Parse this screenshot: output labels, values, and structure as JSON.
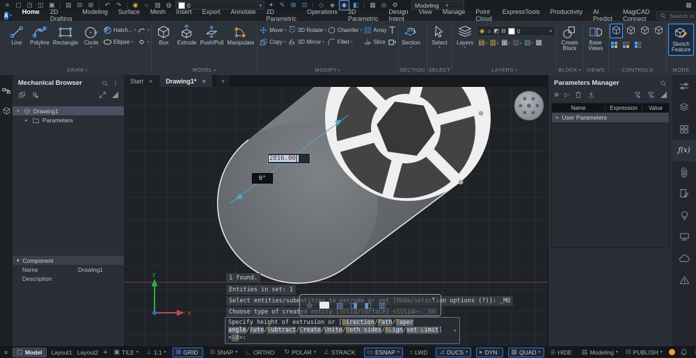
{
  "app": {
    "workspace": "Modeling",
    "search_placeholder": "Search in Ribbon"
  },
  "titlebar": {
    "layer_value": "0"
  },
  "icons": {
    "hamburger": "≡",
    "kebab": "⋮",
    "caret": "▾",
    "close": "×",
    "plus": "+",
    "new": "▢",
    "open": "◳",
    "save": "◫",
    "save_all": "▣",
    "preview": "▤",
    "print": "⊟",
    "plot": "⊞",
    "undo": "↶",
    "redo": "↷",
    "bulb": "◉",
    "sun": "☼",
    "transparency": "▨",
    "render": "◍",
    "annotate_wand": "✦",
    "annotate_pencil": "✎",
    "select_add": "⊞",
    "select_sub": "⊡",
    "view_wire": "◇",
    "view_hidden": "◈",
    "view_shaded": "◆",
    "view_real": "◧",
    "table": "▦",
    "draworder": "◎",
    "gear": "⚙",
    "grip": "▦",
    "fx": "ƒ(x)",
    "orange_dot": "",
    "up_arrow": "▴"
  },
  "menubar": {
    "tabs": [
      {
        "label": "Home",
        "active": true
      },
      {
        "label": "2D Drafting"
      },
      {
        "label": "Modeling"
      },
      {
        "label": "Surface"
      },
      {
        "label": "Mesh"
      },
      {
        "label": "Insert"
      },
      {
        "label": "Export"
      },
      {
        "label": "Annotate"
      },
      {
        "label": "2D Parametric"
      },
      {
        "label": "Operations"
      },
      {
        "label": "3D Parametric"
      },
      {
        "label": "Design Intent"
      },
      {
        "label": "View"
      },
      {
        "label": "Manage"
      },
      {
        "label": "Point Cloud"
      },
      {
        "label": "ExpressTools"
      },
      {
        "label": "Productivity"
      },
      {
        "label": "AI Predict"
      },
      {
        "label": "MagiCAD Connect"
      }
    ]
  },
  "ribbon": {
    "draw": {
      "label": "DRAW",
      "tools": [
        "Line",
        "Polyline",
        "Rectangle",
        "Circle"
      ],
      "small": [
        "Hatch...",
        "Ellipse"
      ]
    },
    "model": {
      "label": "MODEL",
      "tools": [
        "Box",
        "Extrude",
        "Push/Pull",
        "Manipulate"
      ]
    },
    "modify": {
      "label": "MODIFY",
      "row1": [
        "Move",
        "3D Rotate",
        "Chamfer",
        "Array"
      ],
      "row2": [
        "Copy",
        "3D Mirror",
        "Fillet",
        "Slice"
      ]
    },
    "section": {
      "label": "SECTION",
      "tool": "Section"
    },
    "select": {
      "label": "SELECT",
      "tool": "Select"
    },
    "layers": {
      "label": "LAYERS",
      "tool": "Layers",
      "layer_value": "0"
    },
    "block": {
      "label": "BLOCK",
      "tool": "Create Block"
    },
    "views": {
      "label": "VIEWS",
      "tool": "Base Views"
    },
    "controls": {
      "label": "CONTROLS"
    },
    "mode": {
      "label": "MODE",
      "tool": "Sketch Feature"
    }
  },
  "doc_tabs": [
    {
      "label": "Start"
    },
    {
      "label": "Drawing1*",
      "active": true
    }
  ],
  "mech_browser": {
    "title": "Mechanical Browser",
    "tree": {
      "root": "Drawing1",
      "child": "Parameters"
    },
    "component": {
      "title": "Component",
      "name_label": "Name",
      "name_value": "Drawing1",
      "desc_label": "Description",
      "desc_value": ""
    }
  },
  "params_manager": {
    "title": "Parameters Manager",
    "columns": [
      "Name",
      "Expression",
      "Value"
    ],
    "group_row": "User Parameters"
  },
  "viewport": {
    "dim_value": "2816.00",
    "angle_value": "0°",
    "axis_x": "X",
    "axis_y": "Y"
  },
  "command": {
    "history": [
      [
        [
          "p",
          "1 found."
        ]
      ],
      [
        [
          "p",
          "Entities in set: 1"
        ]
      ],
      [
        [
          "p",
          "Select entities/subentities to extrude or set ["
        ],
        [
          "h",
          "MO"
        ],
        [
          "p",
          "de/selection options (?)]: _MO"
        ]
      ],
      [
        [
          "p",
          "Choose type of created entity ["
        ],
        [
          "h",
          "SO"
        ],
        [
          "p",
          "lid/"
        ],
        [
          "h",
          "SU"
        ],
        [
          "p",
          "rface] <"
        ],
        [
          "h",
          "SO"
        ],
        [
          "p",
          "lid>: _SO"
        ]
      ]
    ],
    "prompt": [
      [
        [
          "p",
          "Specify height of extrusion or ["
        ],
        [
          "o",
          "D"
        ],
        [
          "k",
          "irection"
        ],
        [
          "p",
          "/"
        ],
        [
          "o",
          "P"
        ],
        [
          "k",
          "ath"
        ],
        [
          "p",
          "/"
        ],
        [
          "o",
          "T"
        ],
        [
          "k",
          "aper"
        ]
      ],
      [
        [
          "k",
          "angle"
        ],
        [
          "p",
          "/"
        ],
        [
          "o",
          "A"
        ],
        [
          "k",
          "uto"
        ],
        [
          "p",
          "/"
        ],
        [
          "o",
          "S"
        ],
        [
          "k",
          "ubtract"
        ],
        [
          "p",
          "/"
        ],
        [
          "o",
          "C"
        ],
        [
          "k",
          "reate"
        ],
        [
          "p",
          "/"
        ],
        [
          "o",
          "U"
        ],
        [
          "k",
          "nite"
        ],
        [
          "p",
          "/"
        ],
        [
          "o",
          "B"
        ],
        [
          "k",
          "oth sides"
        ],
        [
          "p",
          "/"
        ],
        [
          "o",
          "AL"
        ],
        [
          "k",
          "ign"
        ],
        [
          "p",
          "/"
        ],
        [
          "k",
          "set "
        ],
        [
          "o",
          "L"
        ],
        [
          "k",
          "imit"
        ],
        [
          "p",
          "]"
        ]
      ],
      [
        [
          "p",
          "<"
        ],
        [
          "vk",
          "-4"
        ],
        [
          "p",
          ">:"
        ]
      ]
    ]
  },
  "statusbar": {
    "model_tab": "Model",
    "layouts": [
      "Layout1",
      "Layout2"
    ],
    "toggles": [
      {
        "label": "TILE",
        "icon": "▣",
        "caret": "▾"
      },
      {
        "label": "1:1",
        "icon": "⊥",
        "caret": "▾",
        "color": "#4da3ff"
      },
      {
        "label": "GRID",
        "icon": "⊞",
        "cls": "on",
        "caret": "",
        "color": "#4da3ff"
      },
      {
        "label": "SNAP",
        "icon": "⊞",
        "caret": "▾",
        "color": "#b05555"
      },
      {
        "label": "ORTHO",
        "icon": "∟",
        "caret": ""
      },
      {
        "label": "POLAR",
        "icon": "↻",
        "caret": "▾"
      },
      {
        "label": "STRACK",
        "icon": "∠",
        "caret": "",
        "color": "#b05555"
      },
      {
        "label": "ESNAP",
        "icon": "▭",
        "cls": "on",
        "caret": "▾",
        "color": "#58b0a8"
      },
      {
        "label": "LWD",
        "icon": "=",
        "caret": ""
      },
      {
        "label": "DUCS",
        "icon": "⊿",
        "cls": "on",
        "caret": "▾",
        "color": "#4da3ff"
      },
      {
        "label": "DYN",
        "icon": "▸",
        "cls": "on",
        "caret": ""
      },
      {
        "label": "QUAD",
        "icon": "▦",
        "cls": "on",
        "caret": "▾"
      },
      {
        "label": "HIDE",
        "icon": "◎",
        "caret": ""
      },
      {
        "label": "Modeling",
        "icon": "▤",
        "caret": "▾"
      },
      {
        "label": "PUBLISH",
        "icon": "⊟",
        "caret": "▾"
      }
    ]
  }
}
